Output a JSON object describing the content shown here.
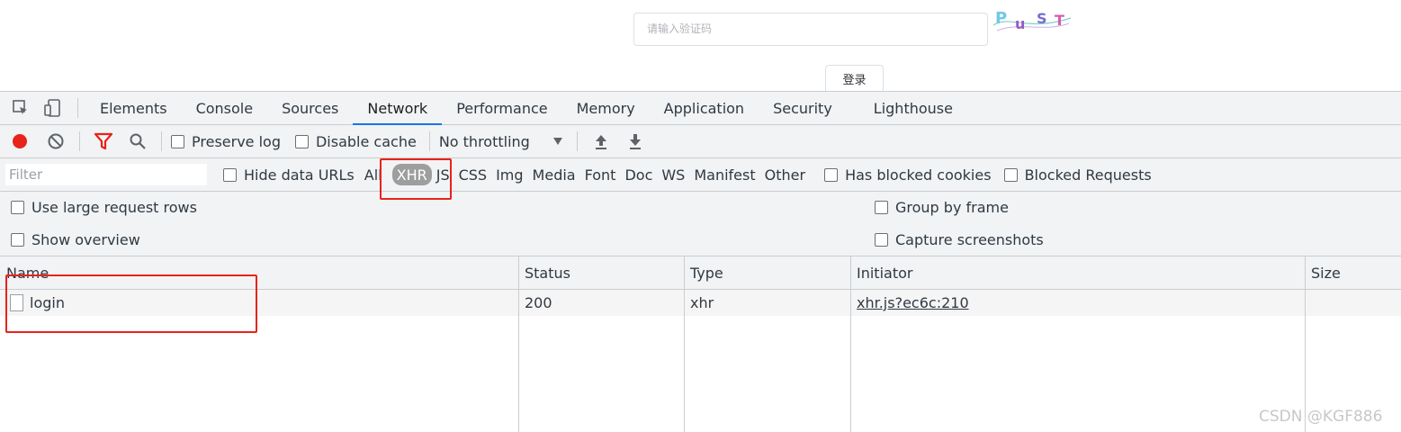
{
  "page": {
    "captcha_placeholder": "请输入验证码",
    "captcha_text": "PuST",
    "login_label": "登录"
  },
  "devtools": {
    "tabs": [
      "Elements",
      "Console",
      "Sources",
      "Network",
      "Performance",
      "Memory",
      "Application",
      "Security",
      "Lighthouse"
    ],
    "active_tab": "Network",
    "toolbar": {
      "preserve_log": "Preserve log",
      "disable_cache": "Disable cache",
      "throttling": "No throttling"
    },
    "filter": {
      "placeholder": "Filter",
      "hide_data_urls": "Hide data URLs",
      "types": [
        "All",
        "XHR",
        "JS",
        "CSS",
        "Img",
        "Media",
        "Font",
        "Doc",
        "WS",
        "Manifest",
        "Other"
      ],
      "selected_type": "XHR",
      "has_blocked_cookies": "Has blocked cookies",
      "blocked_requests": "Blocked Requests"
    },
    "options": {
      "large_rows": "Use large request rows",
      "show_overview": "Show overview",
      "group_by_frame": "Group by frame",
      "capture_screenshots": "Capture screenshots"
    },
    "table": {
      "columns": [
        "Name",
        "Status",
        "Type",
        "Initiator",
        "Size"
      ],
      "rows": [
        {
          "name": "login",
          "status": "200",
          "type": "xhr",
          "initiator": "xhr.js?ec6c:210",
          "size": ""
        }
      ]
    }
  },
  "watermark": "CSDN @KGF886",
  "colors": {
    "accent": "#1a73e8",
    "record": "#e8231a",
    "highlight": "#e8231a",
    "panel_bg": "#f1f3f4"
  }
}
